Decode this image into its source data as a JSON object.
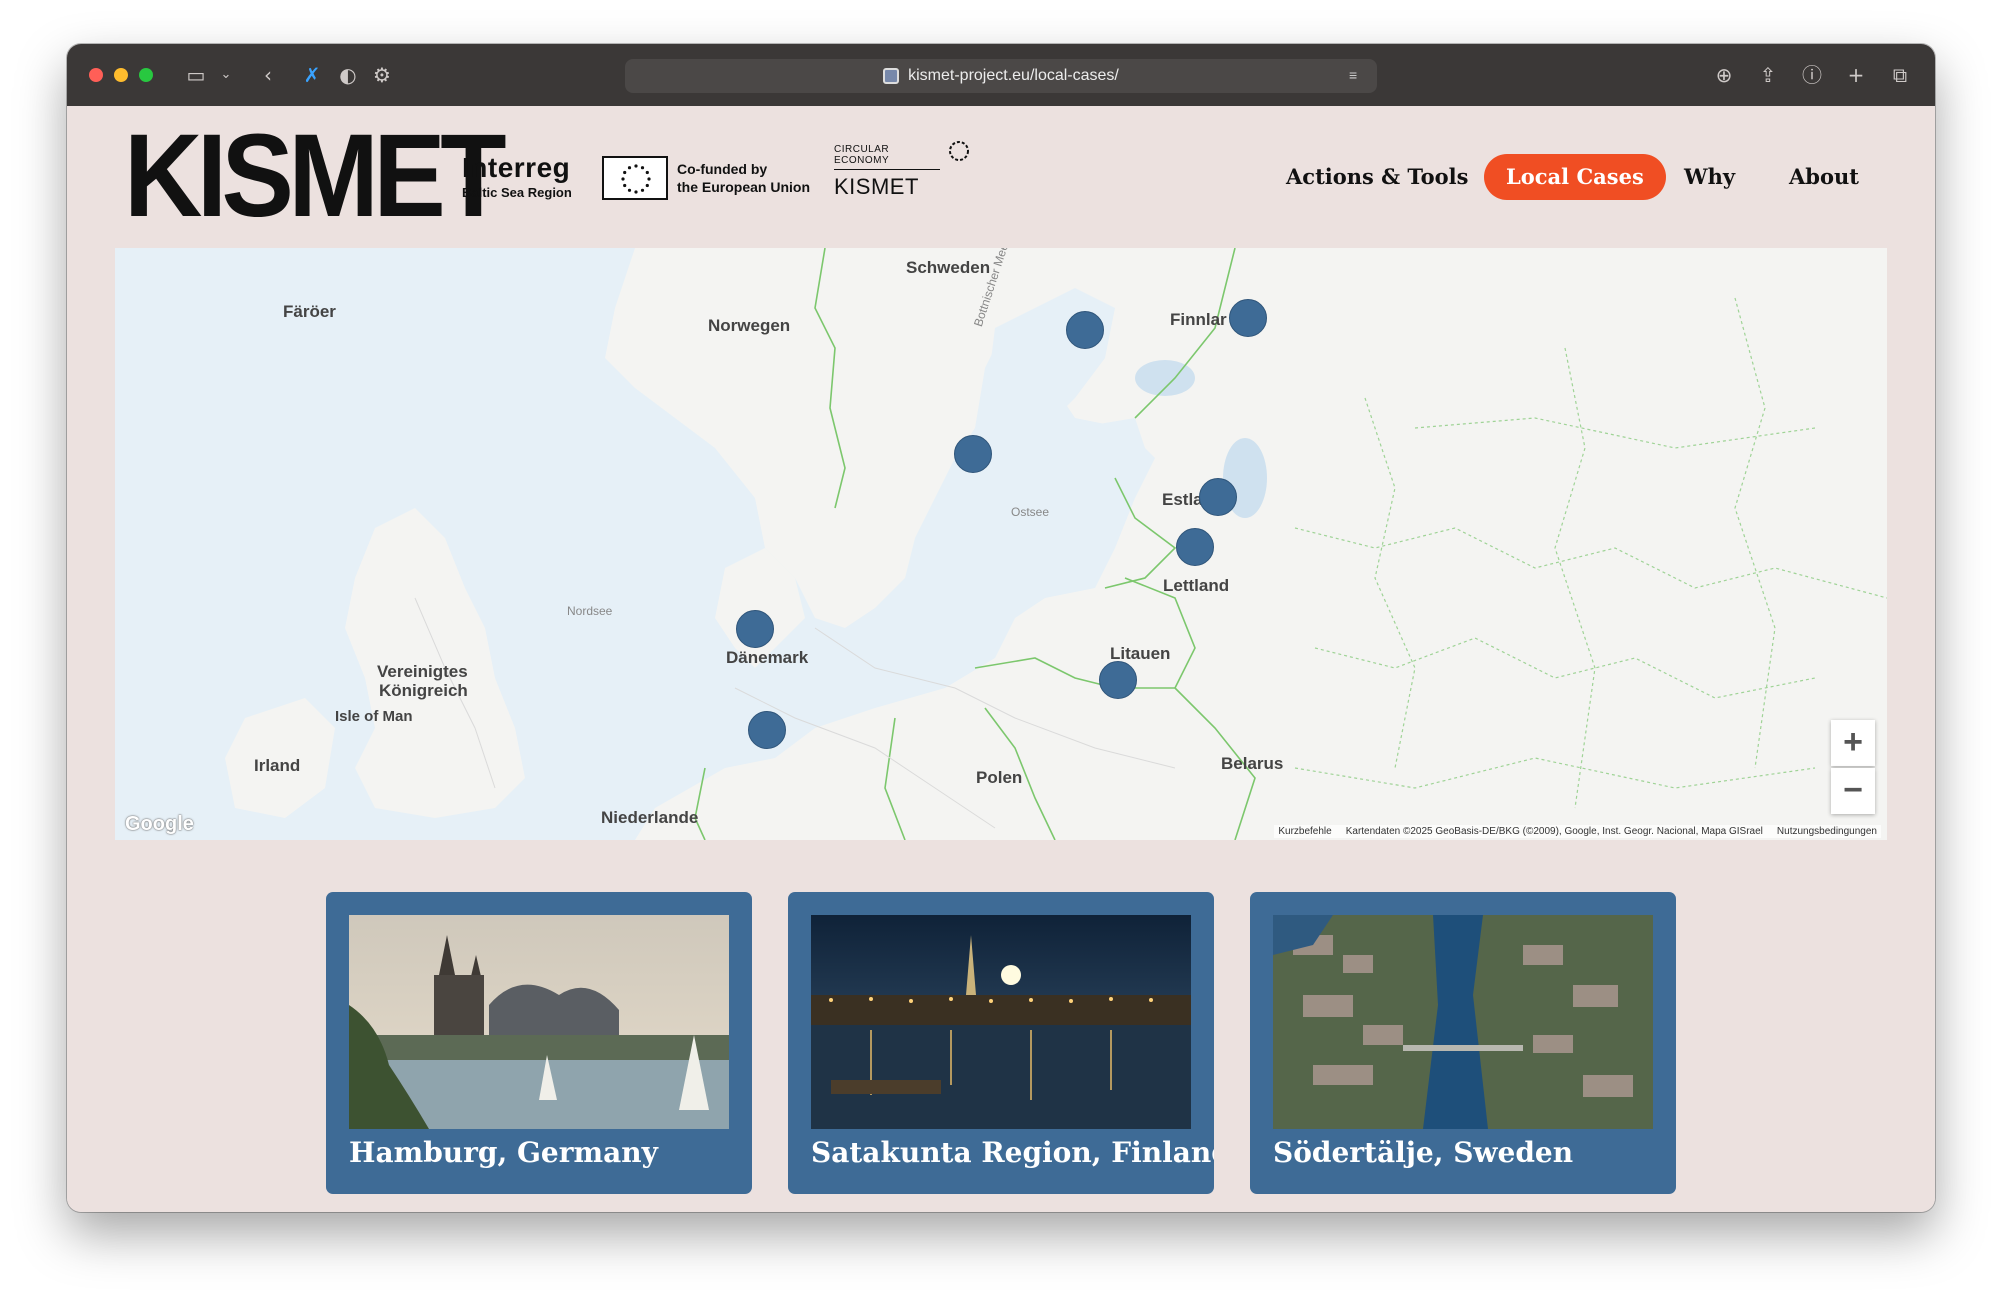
{
  "browser": {
    "url": "kismet-project.eu/local-cases/"
  },
  "header": {
    "logo": "KISMET",
    "interreg_title": "Interreg",
    "interreg_sub": "Baltic Sea Region",
    "cofunded_line1": "Co-funded by",
    "cofunded_line2": "the European Union",
    "circular_label": "CIRCULAR ECONOMY",
    "circular_name": "KISMET"
  },
  "nav": {
    "items": [
      {
        "label": "Actions & Tools",
        "active": false
      },
      {
        "label": "Local Cases",
        "active": true
      },
      {
        "label": "Why",
        "active": false
      },
      {
        "label": "About",
        "active": false
      }
    ]
  },
  "map": {
    "labels": {
      "faroer": "Färöer",
      "norwegen": "Norwegen",
      "schweden": "Schweden",
      "finnland": "Finnlar",
      "estland": "Estla",
      "lettland": "Lettland",
      "litauen": "Litauen",
      "daenemark": "Dänemark",
      "uk1": "Vereinigtes",
      "uk2": "Königreich",
      "isle_of_man": "Isle of Man",
      "irland": "Irland",
      "polen": "Polen",
      "belarus": "Belarus",
      "niederlande": "Niederlande",
      "nordsee": "Nordsee",
      "ostsee": "Ostsee",
      "bothnian": "Bottnischer Meerbusen"
    },
    "zoom_in": "+",
    "zoom_out": "−",
    "google": "Google",
    "attribution": {
      "shortcuts": "Kurzbefehle",
      "data": "Kartendaten ©2025 GeoBasis-DE/BKG (©2009), Google, Inst. Geogr. Nacional, Mapa GISrael",
      "terms": "Nutzungsbedingungen"
    }
  },
  "cards": [
    {
      "title": "Hamburg, Germany"
    },
    {
      "title": "Satakunta Region, Finland"
    },
    {
      "title": "Södertälje, Sweden"
    }
  ],
  "colors": {
    "accent": "#f04e23",
    "card": "#3e6b96",
    "page_bg": "#ece1df"
  }
}
